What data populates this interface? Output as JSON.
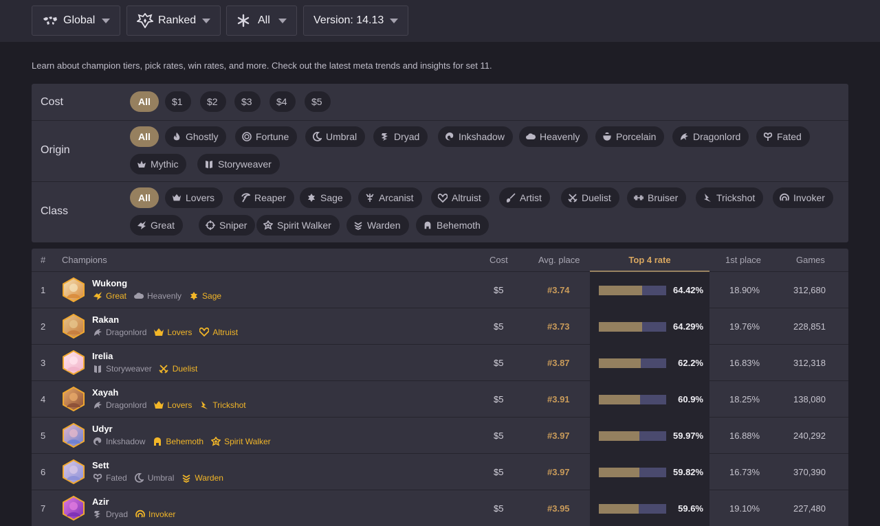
{
  "topbar": {
    "region": {
      "label": "Global",
      "icon": "world-map-icon"
    },
    "queue": {
      "label": "Ranked",
      "icon": "ranked-emblem-icon"
    },
    "mode": {
      "label": "All",
      "icon": "asterisk-icon"
    },
    "version": {
      "label": "Version: 14.13"
    }
  },
  "intro": "Learn about champion tiers, pick rates, win rates, and more. Check out the latest meta trends and insights for set 11.",
  "filters": {
    "cost": {
      "label": "Cost",
      "chips": [
        "All",
        "$1",
        "$2",
        "$3",
        "$4",
        "$5"
      ]
    },
    "origin": {
      "label": "Origin",
      "chips": [
        "All",
        "Ghostly",
        "Fortune",
        "Umbral",
        "Dryad",
        "Inkshadow",
        "Heavenly",
        "Porcelain",
        "Dragonlord",
        "Fated",
        "Mythic",
        "Storyweaver"
      ]
    },
    "class": {
      "label": "Class",
      "chips": [
        "All",
        "Lovers",
        "Reaper",
        "Sage",
        "Arcanist",
        "Altruist",
        "Artist",
        "Duelist",
        "Bruiser",
        "Trickshot",
        "Invoker",
        "Great",
        "Sniper",
        "Spirit Walker",
        "Warden",
        "Behemoth"
      ]
    }
  },
  "table": {
    "headers": {
      "rank": "#",
      "champions": "Champions",
      "cost": "Cost",
      "avg": "Avg. place",
      "top4": "Top 4 rate",
      "first": "1st place",
      "games": "Games"
    },
    "rows": [
      {
        "rank": "1",
        "name": "Wukong",
        "traits": [
          {
            "name": "Great",
            "active": true
          },
          {
            "name": "Heavenly",
            "active": false
          },
          {
            "name": "Sage",
            "active": true
          }
        ],
        "cost": "$5",
        "avg": "#3.74",
        "top4": "64.42%",
        "top4_value": 64.42,
        "first": "18.90%",
        "games": "312,680"
      },
      {
        "rank": "2",
        "name": "Rakan",
        "traits": [
          {
            "name": "Dragonlord",
            "active": false
          },
          {
            "name": "Lovers",
            "active": true
          },
          {
            "name": "Altruist",
            "active": true
          }
        ],
        "cost": "$5",
        "avg": "#3.73",
        "top4": "64.29%",
        "top4_value": 64.29,
        "first": "19.76%",
        "games": "228,851"
      },
      {
        "rank": "3",
        "name": "Irelia",
        "traits": [
          {
            "name": "Storyweaver",
            "active": false
          },
          {
            "name": "Duelist",
            "active": true
          }
        ],
        "cost": "$5",
        "avg": "#3.87",
        "top4": "62.2%",
        "top4_value": 62.2,
        "first": "16.83%",
        "games": "312,318"
      },
      {
        "rank": "4",
        "name": "Xayah",
        "traits": [
          {
            "name": "Dragonlord",
            "active": false
          },
          {
            "name": "Lovers",
            "active": true
          },
          {
            "name": "Trickshot",
            "active": true
          }
        ],
        "cost": "$5",
        "avg": "#3.91",
        "top4": "60.9%",
        "top4_value": 60.9,
        "first": "18.25%",
        "games": "138,080"
      },
      {
        "rank": "5",
        "name": "Udyr",
        "traits": [
          {
            "name": "Inkshadow",
            "active": false
          },
          {
            "name": "Behemoth",
            "active": true
          },
          {
            "name": "Spirit Walker",
            "active": true
          }
        ],
        "cost": "$5",
        "avg": "#3.97",
        "top4": "59.97%",
        "top4_value": 59.97,
        "first": "16.88%",
        "games": "240,292"
      },
      {
        "rank": "6",
        "name": "Sett",
        "traits": [
          {
            "name": "Fated",
            "active": false
          },
          {
            "name": "Umbral",
            "active": false
          },
          {
            "name": "Warden",
            "active": true
          }
        ],
        "cost": "$5",
        "avg": "#3.97",
        "top4": "59.82%",
        "top4_value": 59.82,
        "first": "16.73%",
        "games": "370,390"
      },
      {
        "rank": "7",
        "name": "Azir",
        "traits": [
          {
            "name": "Dryad",
            "active": false
          },
          {
            "name": "Invoker",
            "active": true
          }
        ],
        "cost": "$5",
        "avg": "#3.95",
        "top4": "59.6%",
        "top4_value": 59.6,
        "first": "19.10%",
        "games": "227,480"
      }
    ]
  },
  "colors": {
    "accent": "#96805f",
    "trait_gold": "#f2b628",
    "bar_track": "#4a4a6e",
    "bar_fill": "#94805f"
  }
}
